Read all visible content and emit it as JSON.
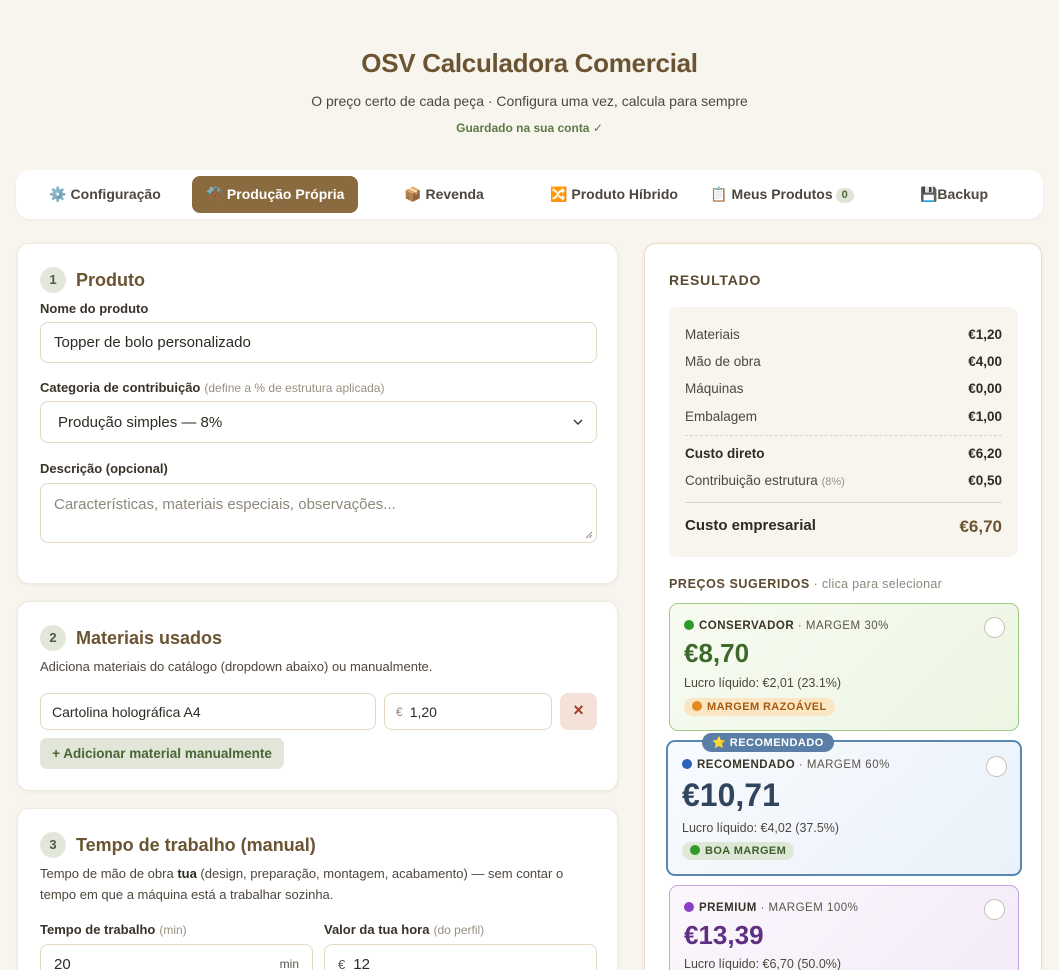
{
  "header": {
    "title": "OSV Calculadora Comercial",
    "subtitle": "O preço certo de cada peça · Configura uma vez, calcula para sempre",
    "saved_status": "Guardado na sua conta ✓"
  },
  "tabs": [
    {
      "icon": "⚙️",
      "label": "Configuração"
    },
    {
      "icon": "⚒️",
      "label": "Produção Própria",
      "active": true
    },
    {
      "icon": "📦",
      "label": "Revenda"
    },
    {
      "icon": "🔀",
      "label": "Produto Híbrido"
    },
    {
      "icon": "📋",
      "label": "Meus Produtos",
      "count": "0"
    },
    {
      "icon": "💾",
      "label": "Backup"
    }
  ],
  "produto": {
    "number": "1",
    "title": "Produto",
    "name_label": "Nome do produto",
    "name_value": "Topper de bolo personalizado",
    "category_label": "Categoria de contribuição",
    "category_hint": "(define a % de estrutura aplicada)",
    "category_value": "Produção simples — 8%",
    "description_label": "Descrição (opcional)",
    "description_placeholder": "Características, materiais especiais, observações..."
  },
  "materiais": {
    "number": "2",
    "title": "Materiais usados",
    "description": "Adiciona materiais do catálogo (dropdown abaixo) ou manualmente.",
    "items": [
      {
        "name": "Cartolina holográfica A4",
        "currency": "€",
        "price": "1,20",
        "remove": "×"
      }
    ],
    "add_button": "+ Adicionar material manualmente"
  },
  "tempo": {
    "number": "3",
    "title": "Tempo de trabalho (manual)",
    "desc_before": "Tempo de mão de obra ",
    "desc_bold": "tua",
    "desc_after": " (design, preparação, montagem, acabamento) — sem contar o tempo em que a máquina está a trabalhar sozinha.",
    "time_label": "Tempo de trabalho",
    "time_hint": "(min)",
    "time_value": "20",
    "time_unit": "min",
    "rate_label": "Valor da tua hora",
    "rate_hint": "(do perfil)",
    "rate_currency": "€",
    "rate_value": "12"
  },
  "resultado": {
    "title": "RESULTADO",
    "rows": [
      {
        "label": "Materiais",
        "value": "€1,20"
      },
      {
        "label": "Mão de obra",
        "value": "€4,00"
      },
      {
        "label": "Máquinas",
        "value": "€0,00"
      },
      {
        "label": "Embalagem",
        "value": "€1,00"
      }
    ],
    "direct_label": "Custo direto",
    "direct_value": "€6,20",
    "structure_label": "Contribuição estrutura",
    "structure_pct": "(8%)",
    "structure_value": "€0,50",
    "total_label": "Custo empresarial",
    "total_value": "€6,70",
    "suggest_title": "PREÇOS SUGERIDOS",
    "suggest_hint": " · clica para selecionar",
    "options": [
      {
        "level": "CONSERVADOR",
        "margin": " · MARGEM 30%",
        "price": "€8,70",
        "profit": "Lucro líquido: €2,01 (23.1%)",
        "badge": "MARGEM RAZOÁVEL",
        "color": "#2f9a2a"
      },
      {
        "level": "RECOMENDADO",
        "margin": " · MARGEM 60%",
        "price": "€10,71",
        "profit": "Lucro líquido: €4,02 (37.5%)",
        "badge": "BOA MARGEM",
        "tag": "⭐ RECOMENDADO",
        "color": "#2a62b8"
      },
      {
        "level": "PREMIUM",
        "margin": " · MARGEM 100%",
        "price": "€13,39",
        "profit": "Lucro líquido: €6,70 (50.0%)",
        "color": "#8a3fc4"
      }
    ]
  }
}
